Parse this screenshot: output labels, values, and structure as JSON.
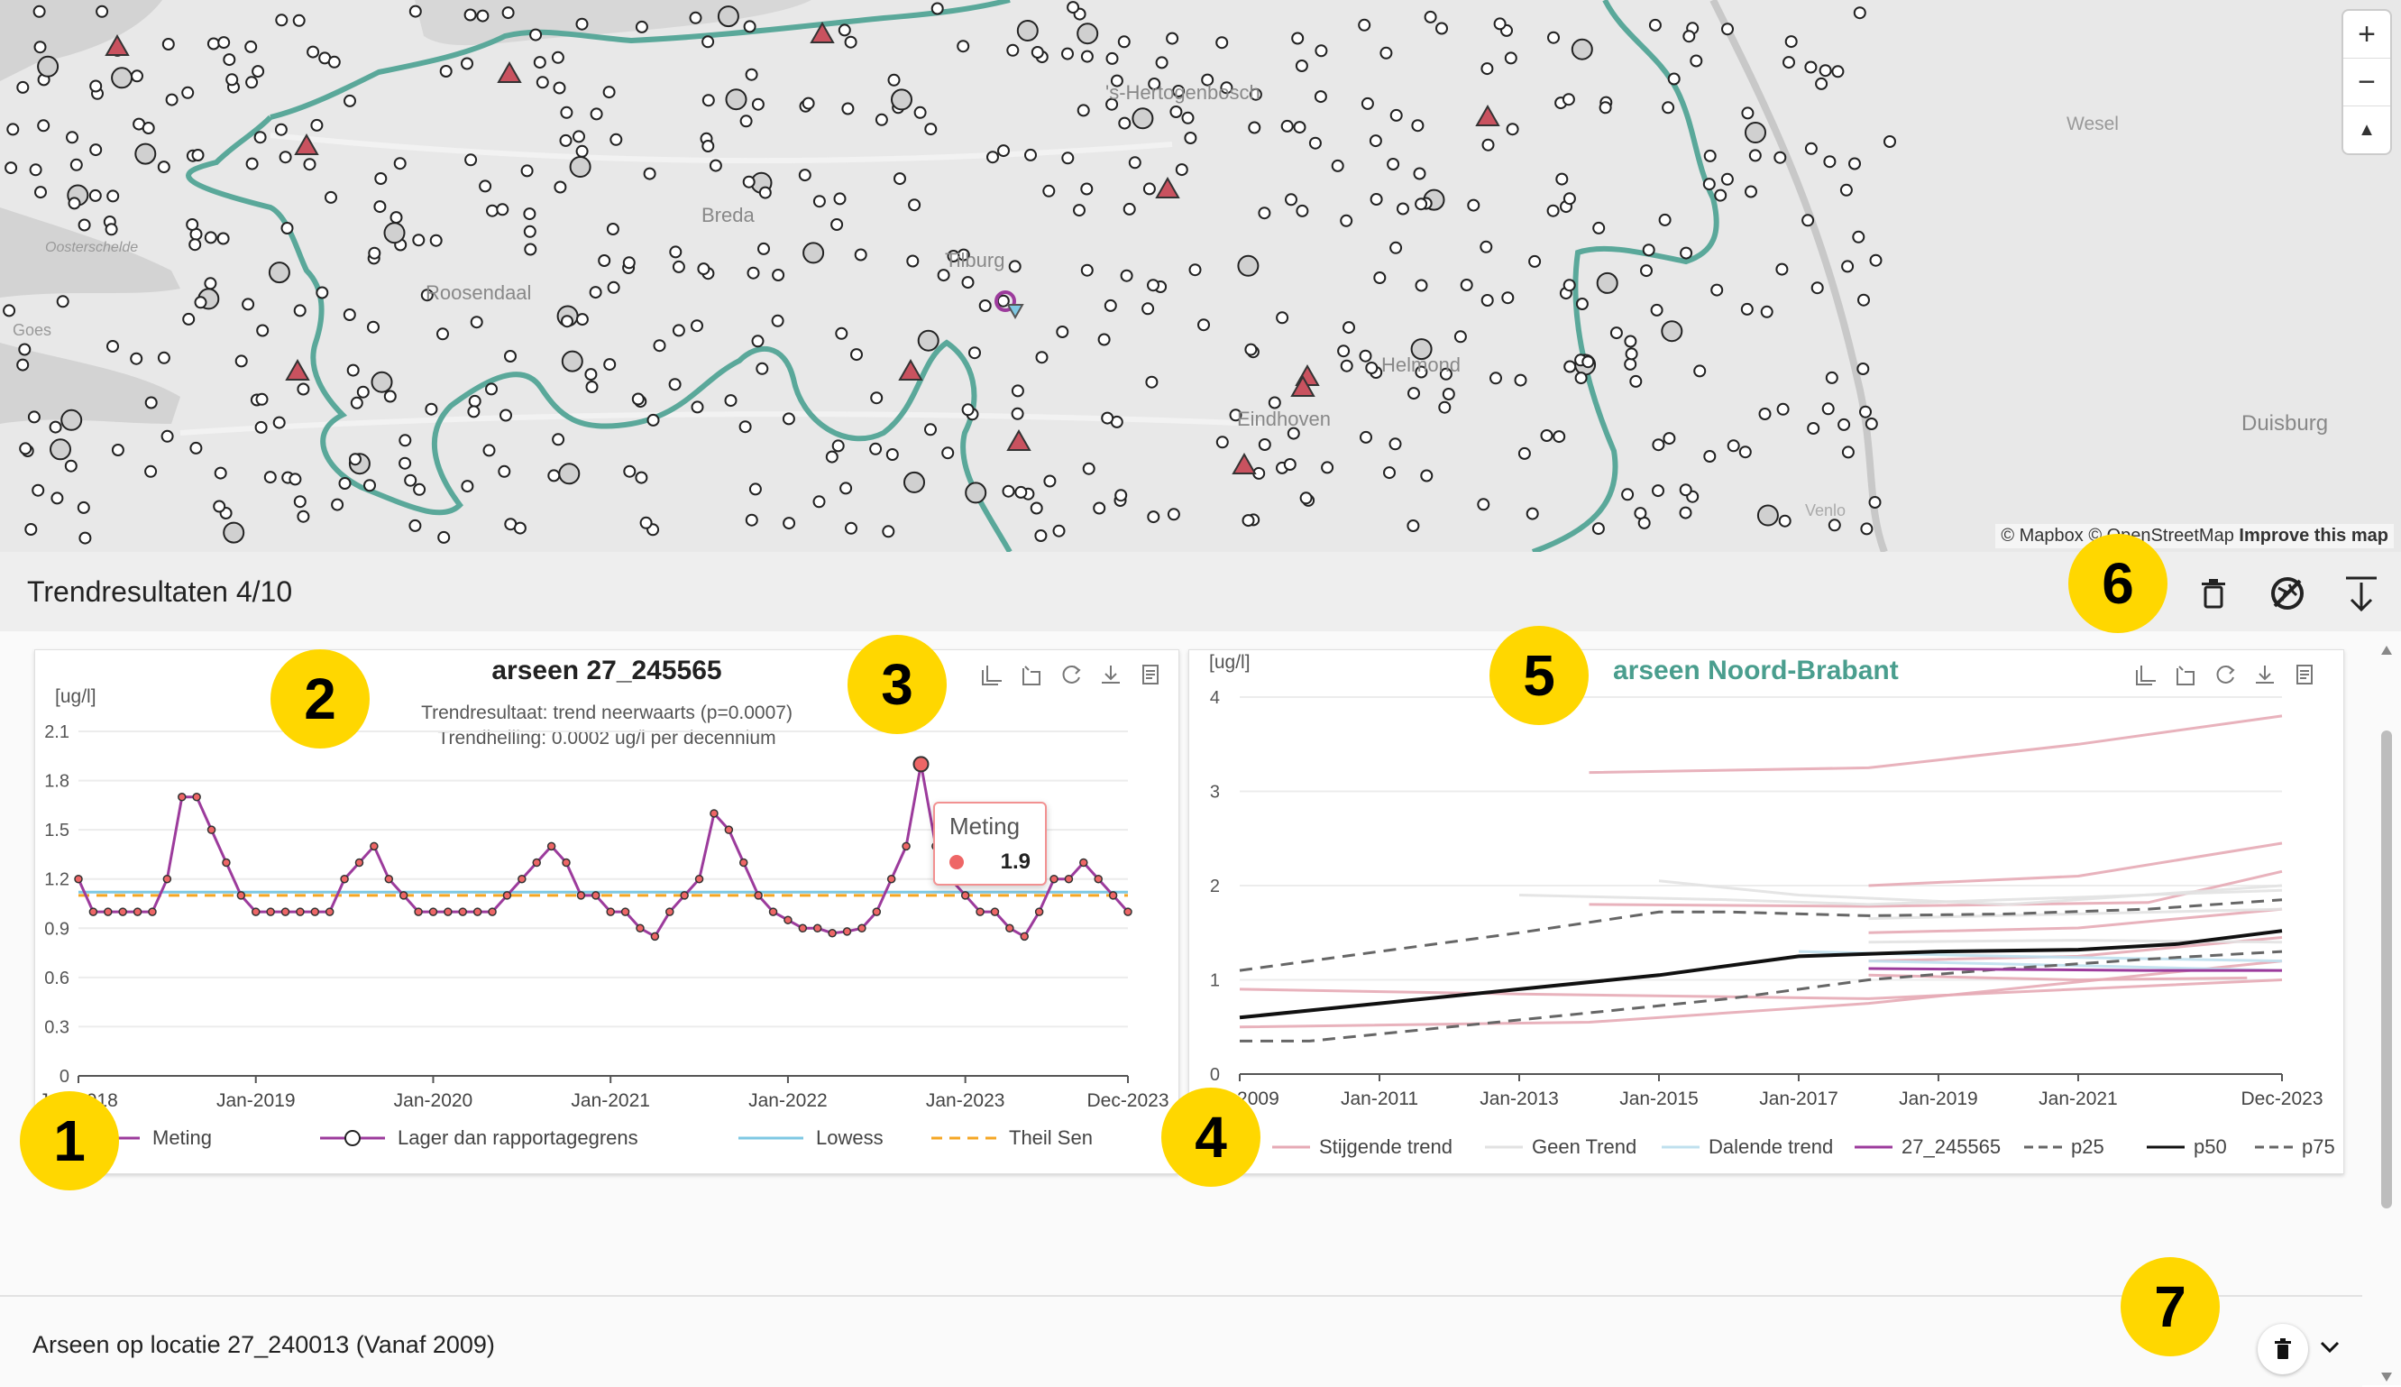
{
  "map": {
    "places": [
      "Tilburg",
      "Breda",
      "Roosendaal",
      "Eindhoven",
      "Helmond",
      "Goes",
      "Oosterschelde",
      "Wesel",
      "Duisburg",
      "Venlo",
      "'s-Hertogenbosch"
    ],
    "attribution": "© Mapbox © OpenStreetMap",
    "improve_link": "Improve this map",
    "zoom_in": "+",
    "zoom_out": "−",
    "compass": "▲"
  },
  "panel": {
    "title": "Trendresultaten 4/10"
  },
  "chart_data": [
    {
      "type": "line",
      "title": "arseen 27_245565",
      "subtitle": [
        "Trendresultaat: trend neerwaarts (p=0.0007)",
        "Trendhelling: 0.0002 ug/l per decennium"
      ],
      "ylabel": "[ug/l]",
      "ylim": [
        0,
        2.1
      ],
      "yticks": [
        "2.1",
        "1.8",
        "1.5",
        "1.2",
        "0.9",
        "0.6",
        "0.3",
        "0"
      ],
      "xlim": [
        "2018-01",
        "2023-12"
      ],
      "xticks": [
        "Jan-2018",
        "Jan-2019",
        "Jan-2020",
        "Jan-2021",
        "Jan-2022",
        "Jan-2023",
        "Dec-2023"
      ],
      "series": [
        {
          "name": "Meting",
          "x": [
            "2018-01",
            "2018-02",
            "2018-03",
            "2018-04",
            "2018-05",
            "2018-06",
            "2018-07",
            "2018-08",
            "2018-09",
            "2018-10",
            "2018-11",
            "2018-12",
            "2019-01",
            "2019-02",
            "2019-03",
            "2019-04",
            "2019-05",
            "2019-06",
            "2019-07",
            "2019-08",
            "2019-09",
            "2019-10",
            "2019-11",
            "2019-12",
            "2020-01",
            "2020-02",
            "2020-03",
            "2020-04",
            "2020-05",
            "2020-06",
            "2020-07",
            "2020-08",
            "2020-09",
            "2020-10",
            "2020-11",
            "2020-12",
            "2021-01",
            "2021-02",
            "2021-03",
            "2021-04",
            "2021-05",
            "2021-06",
            "2021-07",
            "2021-08",
            "2021-09",
            "2021-10",
            "2021-11",
            "2021-12",
            "2022-01",
            "2022-02",
            "2022-03",
            "2022-04",
            "2022-05",
            "2022-06",
            "2022-07",
            "2022-08",
            "2022-09",
            "2022-10",
            "2022-11",
            "2022-12",
            "2023-01",
            "2023-02",
            "2023-03",
            "2023-04",
            "2023-05",
            "2023-06",
            "2023-07",
            "2023-08",
            "2023-09",
            "2023-10",
            "2023-11",
            "2023-12"
          ],
          "values": [
            1.2,
            1.0,
            1.0,
            1.0,
            1.0,
            1.0,
            1.2,
            1.7,
            1.7,
            1.5,
            1.3,
            1.1,
            1.0,
            1.0,
            1.0,
            1.0,
            1.0,
            1.0,
            1.2,
            1.3,
            1.4,
            1.2,
            1.1,
            1.0,
            1.0,
            1.0,
            1.0,
            1.0,
            1.0,
            1.1,
            1.2,
            1.3,
            1.4,
            1.3,
            1.1,
            1.1,
            1.0,
            1.0,
            0.9,
            0.85,
            1.0,
            1.1,
            1.2,
            1.6,
            1.5,
            1.3,
            1.1,
            1.0,
            0.95,
            0.9,
            0.9,
            0.87,
            0.88,
            0.9,
            1.0,
            1.2,
            1.4,
            1.9,
            1.4,
            1.2,
            1.1,
            1.0,
            1.0,
            0.9,
            0.85,
            1.0,
            1.2,
            1.2,
            1.3,
            1.2,
            1.1,
            1.0
          ]
        },
        {
          "name": "Lager dan rapportagegrens",
          "values": []
        },
        {
          "name": "Lowess",
          "values": [
            1.12,
            1.12
          ]
        },
        {
          "name": "Theil Sen",
          "values": [
            1.1,
            1.1
          ]
        }
      ],
      "tooltip": {
        "title": "Meting",
        "value": "1.9"
      }
    },
    {
      "type": "line",
      "title": "arseen Noord-Brabant",
      "ylabel": "[ug/l]",
      "ylim": [
        0,
        4
      ],
      "yticks": [
        "4",
        "3",
        "2",
        "1",
        "0"
      ],
      "xlim": [
        "2009-01",
        "2023-12"
      ],
      "xticks": [
        "Jan-2009",
        "Jan-2011",
        "Jan-2013",
        "Jan-2015",
        "Jan-2017",
        "Jan-2019",
        "Jan-2021",
        "Dec-2023"
      ],
      "series": [
        {
          "name": "p25",
          "x": [
            "2009-01",
            "2010-01",
            "2012-01",
            "2014-01",
            "2016-01",
            "2018-01",
            "2020-01",
            "2022-01",
            "2023-12"
          ],
          "values": [
            0.35,
            0.35,
            0.5,
            0.65,
            0.8,
            1.0,
            1.12,
            1.22,
            1.3
          ]
        },
        {
          "name": "p50",
          "x": [
            "2009-01",
            "2011-01",
            "2013-01",
            "2015-01",
            "2017-01",
            "2019-01",
            "2021-01",
            "2022-06",
            "2023-12"
          ],
          "values": [
            0.6,
            0.75,
            0.9,
            1.05,
            1.25,
            1.3,
            1.32,
            1.38,
            1.52
          ]
        },
        {
          "name": "p75",
          "x": [
            "2009-01",
            "2011-01",
            "2013-01",
            "2015-01",
            "2016-01",
            "2018-01",
            "2020-01",
            "2022-01",
            "2023-12"
          ],
          "values": [
            1.1,
            1.3,
            1.5,
            1.72,
            1.72,
            1.68,
            1.7,
            1.75,
            1.85
          ]
        },
        {
          "name": "27_245565",
          "x": [
            "2018-01",
            "2020-01",
            "2022-01",
            "2023-12"
          ],
          "values": [
            1.12,
            1.11,
            1.1,
            1.1
          ]
        },
        {
          "name": "Stijgende trend",
          "values": []
        },
        {
          "name": "Geen Trend",
          "values": []
        },
        {
          "name": "Dalende trend",
          "values": []
        }
      ]
    }
  ],
  "legend1": [
    "Meting",
    "Lager dan rapportagegrens",
    "Lowess",
    "Theil Sen"
  ],
  "legend2": [
    "Stijgende trend",
    "Geen Trend",
    "Dalende trend",
    "27_245565",
    "p25",
    "p50",
    "p75"
  ],
  "badges": [
    "1",
    "2",
    "3",
    "4",
    "5",
    "6",
    "7"
  ],
  "row2": {
    "label": "Arseen op locatie 27_240013 (Vanaf 2009)"
  },
  "icons": {
    "toolbox": [
      "zoom-select-icon",
      "zoom-reset-icon",
      "restore-icon",
      "download-icon",
      "data-view-icon"
    ],
    "header": [
      "delete-icon",
      "hide-map-icon",
      "collapse-icon"
    ]
  },
  "colors": {
    "boundary": "#5aa89a",
    "meting": "#9c3b9c",
    "meting_dot": "#ee6666",
    "lowess": "#7ec8e3",
    "theil_sen": "#f5a623",
    "warning_triangle": "#c9525f",
    "badge": "#ffd700",
    "title2": "#4a9e8e"
  }
}
